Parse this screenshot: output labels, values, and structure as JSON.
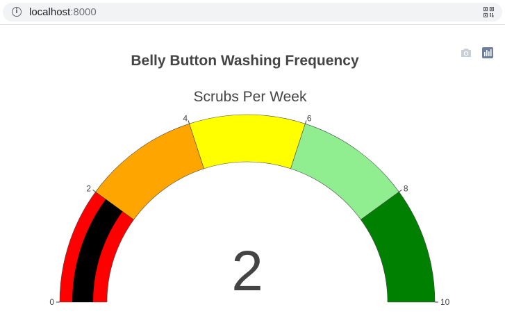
{
  "browser": {
    "url_host": "localhost",
    "url_port": ":8000"
  },
  "modebar": {
    "icons": [
      "camera-icon",
      "plotly-logo-icon"
    ]
  },
  "chart_data": {
    "type": "gauge",
    "title": "Belly Button Washing Frequency",
    "subtitle": "Scrubs Per Week",
    "value": 2,
    "range": [
      0,
      10
    ],
    "tick_values": [
      0,
      2,
      4,
      6,
      8,
      10
    ],
    "tick_labels": [
      "0",
      "2",
      "4",
      "6",
      "8",
      "10"
    ],
    "steps": [
      {
        "range": [
          0,
          2
        ],
        "color": "#ff0000"
      },
      {
        "range": [
          2,
          4
        ],
        "color": "#ffa500"
      },
      {
        "range": [
          4,
          6
        ],
        "color": "#ffff00"
      },
      {
        "range": [
          6,
          8
        ],
        "color": "#90ee90"
      },
      {
        "range": [
          8,
          10
        ],
        "color": "#008000"
      }
    ],
    "bar_color": "#000000"
  }
}
